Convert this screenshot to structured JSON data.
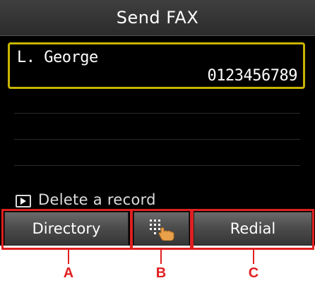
{
  "title": "Send FAX",
  "record": {
    "name": "L. George",
    "number": "0123456789"
  },
  "hint": {
    "icon": "play-icon",
    "text": "Delete a record"
  },
  "softkeys": {
    "left_label": "Directory",
    "middle_icon": "dial-pad-touch-icon",
    "right_label": "Redial"
  },
  "callouts": [
    "A",
    "B",
    "C"
  ],
  "colors": {
    "selection_border": "#c8b400",
    "callout_red": "#e02020"
  }
}
